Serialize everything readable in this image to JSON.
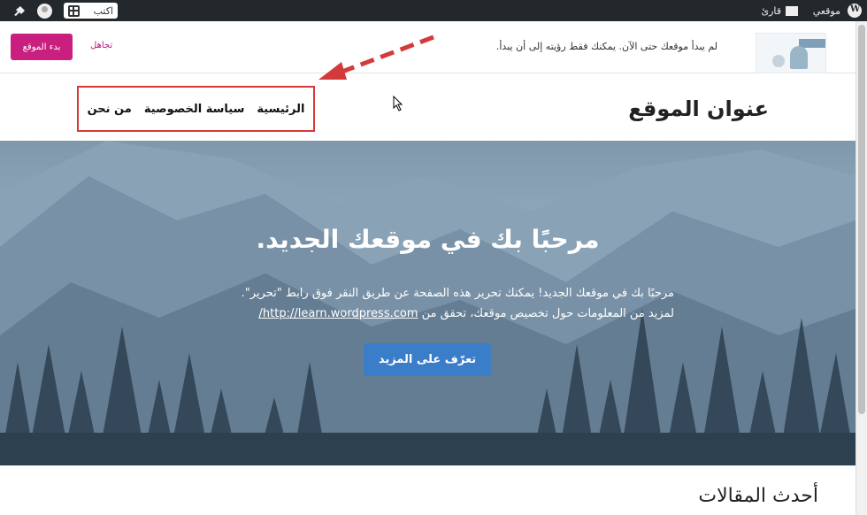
{
  "admin_bar": {
    "site_label": "موقعي",
    "reader_label": "قارئ",
    "write_label": "اكتب",
    "icons": [
      "wordpress-icon",
      "reader-icon",
      "write-icon",
      "avatar-icon",
      "notifications-icon"
    ]
  },
  "launch_banner": {
    "text": "لم يبدأ موقعك حتى الآن. يمكنك فقط رؤيته إلى أن يبدأ.",
    "dismiss_label": "تجاهل",
    "launch_button_label": "بدء الموقع",
    "launch_button_color": "#c9207f"
  },
  "site_header": {
    "title": "عنوان الموقع",
    "nav_items": [
      {
        "label": "الرئيسية"
      },
      {
        "label": "سياسة الخصوصية"
      },
      {
        "label": "من نحن"
      }
    ],
    "highlight_color": "#d33a3a"
  },
  "hero": {
    "title": "مرحبًا بك في موقعك الجديد.",
    "line1": "مرحبًا بك في موقعك الجديد! يمكنك تحرير هذه الصفحة عن طريق النقر فوق رابط \"تحرير\".",
    "line2_prefix": "لمزيد من المعلومات حول تخصيص موقعك، تحقق من",
    "link_text": "http://learn.wordpress.com/",
    "button_label": "تعرّف على المزيد",
    "button_color": "#3a7dc9"
  },
  "latest_posts": {
    "title": "أحدث المقالات"
  }
}
